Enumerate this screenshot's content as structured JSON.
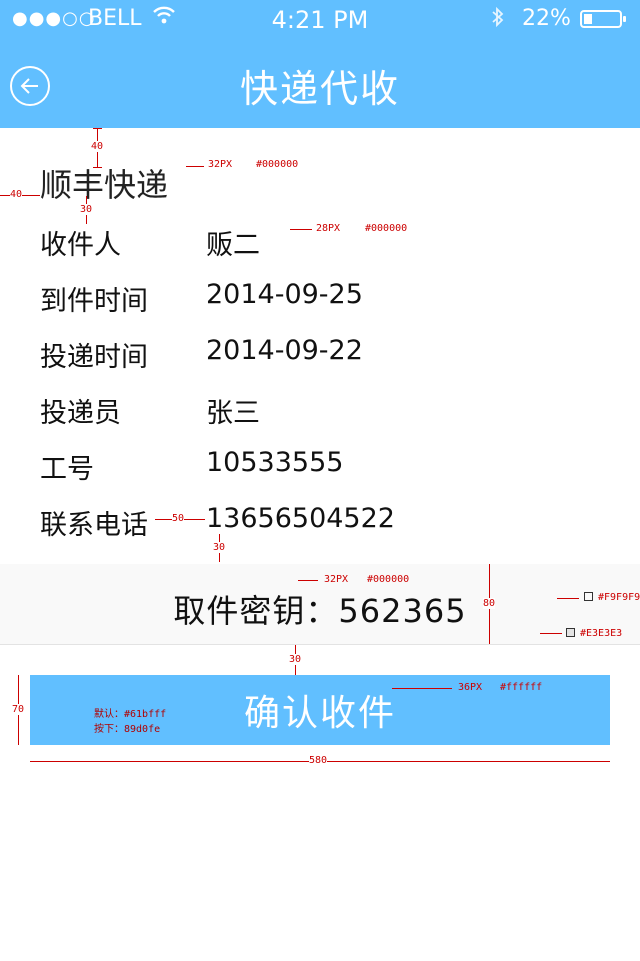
{
  "status_bar": {
    "signal_dots": "●●●○○",
    "carrier": "BELL",
    "time": "4:21 PM",
    "battery": "22%",
    "battery_level": 0.22
  },
  "nav": {
    "title": "快递代收"
  },
  "courier": "顺丰快递",
  "details": [
    {
      "label": "收件人",
      "value": "贩二"
    },
    {
      "label": "到件时间",
      "value": "2014-09-25"
    },
    {
      "label": "投递时间",
      "value": "2014-09-22"
    },
    {
      "label": "投递员",
      "value": "张三"
    },
    {
      "label": "工号",
      "value": "10533555"
    },
    {
      "label": "联系电话",
      "value": "13656504522"
    }
  ],
  "pickup": {
    "label": "取件密钥：",
    "code": "562365"
  },
  "confirm_button": {
    "label": "确认收件"
  },
  "annotations": {
    "company_font": "32PX",
    "company_color": "#000000",
    "row_font": "28PX",
    "row_color": "#000000",
    "key_font": "32PX",
    "key_color": "#000000",
    "btn_font": "36PX",
    "btn_color": "#ffffff",
    "bg_color_1": "#F9F9F9",
    "bg_color_2": "#E3E3E3",
    "btn_default": "默认：#61bfff",
    "btn_pressed": "按下：89d0fe",
    "d40a": "40",
    "d40b": "40",
    "d30a": "30",
    "d50": "50",
    "d30b": "30",
    "d80": "80",
    "d30c": "30",
    "d70": "70",
    "d580": "580"
  }
}
